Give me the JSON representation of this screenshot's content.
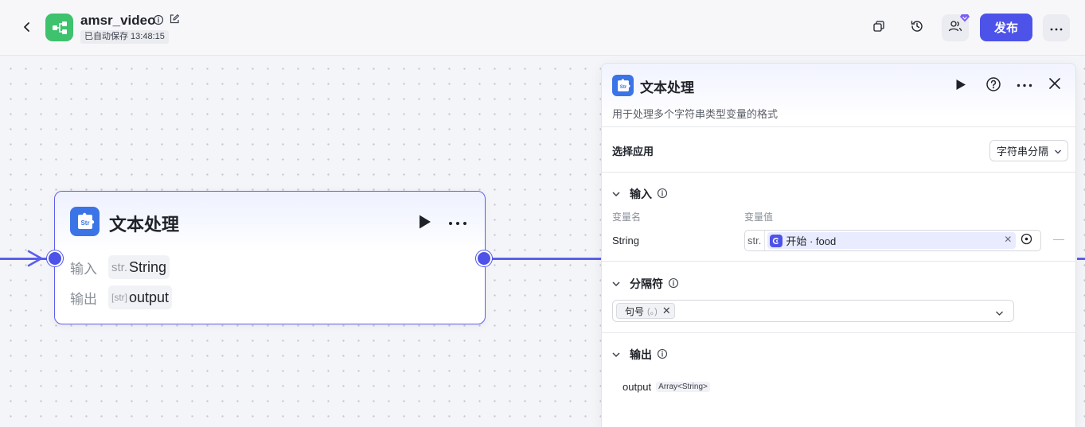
{
  "header": {
    "app_name": "amsr_video",
    "save_status": "已自动保存 13:48:15",
    "publish_label": "发布"
  },
  "node": {
    "title": "文本处理",
    "icon_text": "Str",
    "input_label": "输入",
    "input_type": "str.",
    "input_value": "String",
    "output_label": "输出",
    "output_type": "[str]",
    "output_value": "output"
  },
  "panel": {
    "title": "文本处理",
    "icon_text": "Str",
    "description": "用于处理多个字符串类型变量的格式",
    "select_label": "选择应用",
    "select_value": "字符串分隔",
    "input_section": {
      "title": "输入",
      "col_name": "变量名",
      "col_value": "变量值",
      "var_name": "String",
      "var_type": "str.",
      "ref_text": "开始 · food"
    },
    "separator_section": {
      "title": "分隔符",
      "chip_label": "句号",
      "chip_hint": "(。)"
    },
    "output_section": {
      "title": "输出",
      "var_name": "output",
      "var_type": "Array<String>"
    }
  },
  "colors": {
    "accent": "#4d53e8",
    "app_icon": "#3ec26d",
    "node_icon": "#3b74e6"
  }
}
